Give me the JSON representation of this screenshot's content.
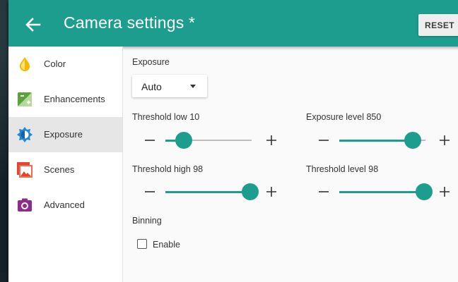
{
  "header": {
    "title": "Camera settings *",
    "back_icon": "arrow-left-icon",
    "reset_label": "RESET",
    "accent_color": "#1c9d8e"
  },
  "sidebar": {
    "items": [
      {
        "label": "Color",
        "icon": "color-drop-icon",
        "icon_color": "#f5b800",
        "active": false
      },
      {
        "label": "Enhancements",
        "icon": "enhancements-icon",
        "icon_color": "#5aa33a",
        "active": false
      },
      {
        "label": "Exposure",
        "icon": "exposure-icon",
        "icon_color": "#2289d6",
        "active": true
      },
      {
        "label": "Scenes",
        "icon": "scenes-icon",
        "icon_color": "#e5442f",
        "active": false
      },
      {
        "label": "Advanced",
        "icon": "camera-icon",
        "icon_color": "#8e2b8c",
        "active": false
      }
    ]
  },
  "exposure": {
    "mode_label": "Exposure",
    "mode_value": "Auto"
  },
  "sliders": {
    "threshold_low": {
      "name": "Threshold low",
      "value": "10",
      "fraction": 0.21
    },
    "exposure_level": {
      "name": "Exposure level",
      "value": "850",
      "fraction": 0.85
    },
    "threshold_high": {
      "name": "Threshold high",
      "value": "98",
      "fraction": 0.98
    },
    "threshold_level": {
      "name": "Threshold level",
      "value": "98",
      "fraction": 0.98
    }
  },
  "binning": {
    "label": "Binning",
    "checkbox_label": "Enable",
    "checked": false
  }
}
